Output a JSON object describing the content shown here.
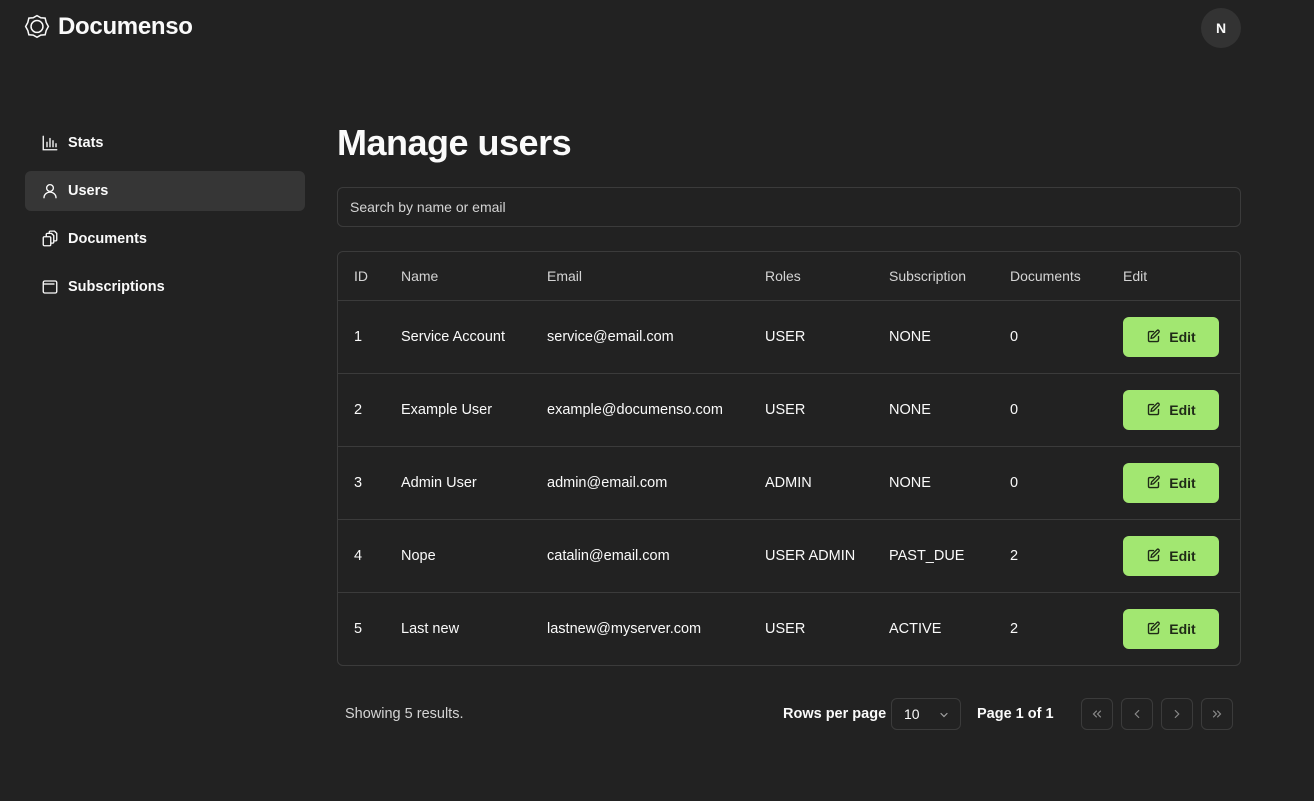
{
  "app": {
    "name": "Documenso"
  },
  "user": {
    "initial": "N"
  },
  "sidebar": {
    "items": [
      {
        "label": "Stats",
        "icon": "bar-chart-icon",
        "active": false
      },
      {
        "label": "Users",
        "icon": "user-icon",
        "active": true
      },
      {
        "label": "Documents",
        "icon": "files-icon",
        "active": false
      },
      {
        "label": "Subscriptions",
        "icon": "wallet-icon",
        "active": false
      }
    ]
  },
  "main": {
    "title": "Manage users",
    "search": {
      "placeholder": "Search by name or email",
      "value": ""
    },
    "table": {
      "columns": [
        "ID",
        "Name",
        "Email",
        "Roles",
        "Subscription",
        "Documents",
        "Edit"
      ],
      "rows": [
        {
          "id": "1",
          "name": "Service Account",
          "email": "service@email.com",
          "roles": "USER",
          "subscription": "NONE",
          "documents": "0",
          "edit": "Edit"
        },
        {
          "id": "2",
          "name": "Example User",
          "email": "example@documenso.com",
          "roles": "USER",
          "subscription": "NONE",
          "documents": "0",
          "edit": "Edit"
        },
        {
          "id": "3",
          "name": "Admin User",
          "email": "admin@email.com",
          "roles": "ADMIN",
          "subscription": "NONE",
          "documents": "0",
          "edit": "Edit"
        },
        {
          "id": "4",
          "name": "Nope",
          "email": "catalin@email.com",
          "roles": "USER ADMIN",
          "subscription": "PAST_DUE",
          "documents": "2",
          "edit": "Edit"
        },
        {
          "id": "5",
          "name": "Last new",
          "email": "lastnew@myserver.com",
          "roles": "USER",
          "subscription": "ACTIVE",
          "documents": "2",
          "edit": "Edit"
        }
      ]
    },
    "pagination": {
      "results_text": "Showing 5 results.",
      "rows_per_page_label": "Rows per page",
      "rows_per_page_value": "10",
      "page_info": "Page 1 of 1"
    }
  },
  "colors": {
    "background": "#222222",
    "accent": "#a2e771",
    "border": "#3b3b3b",
    "active_item": "#363636"
  }
}
